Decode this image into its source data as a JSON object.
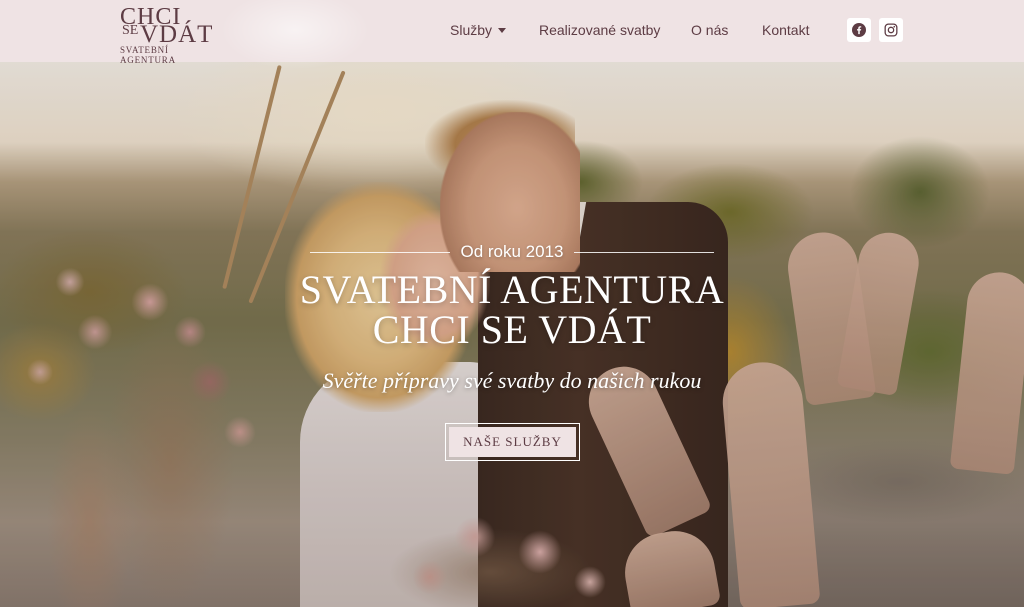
{
  "logo": {
    "line1": "CHCI",
    "line2_small": "SE",
    "line2_big": "VDÁT",
    "line3": "SVATEBNÍ AGENTURA"
  },
  "nav": {
    "items": [
      {
        "label": "Služby",
        "has_dropdown": true
      },
      {
        "label": "Realizované svatby",
        "has_dropdown": false
      },
      {
        "label": "O nás",
        "has_dropdown": false
      },
      {
        "label": "Kontakt",
        "has_dropdown": false
      }
    ],
    "social": [
      {
        "icon": "facebook-icon"
      },
      {
        "icon": "instagram-icon"
      }
    ]
  },
  "hero": {
    "since": "Od roku 2013",
    "headline_line1": "SVATEBNÍ AGENTURA",
    "headline_line2": "CHCI SE VDÁT",
    "tagline": "Svěřte přípravy své svatby do našich rukou",
    "cta_label": "NAŠE SLUŽBY"
  },
  "colors": {
    "header_bg": "#efe3e4",
    "brand_text": "#5d3c44",
    "hero_text": "#ffffff"
  }
}
